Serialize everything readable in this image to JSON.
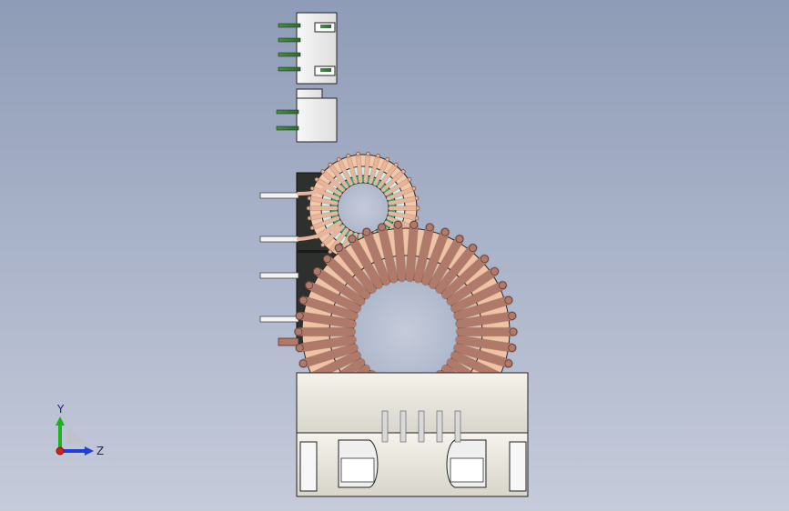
{
  "viewport": {
    "background_top": "#8f9cb7",
    "background_bottom": "#c6cbda"
  },
  "triad": {
    "x_label": "",
    "y_label": "Y",
    "z_label": "Z",
    "y_color": "#1db31d",
    "z_color": "#1f3fd6",
    "x_color": "#d21f1f"
  },
  "model": {
    "parts": [
      {
        "name": "connector-4pin",
        "icon": "connector-icon"
      },
      {
        "name": "connector-2pin",
        "icon": "connector-icon"
      },
      {
        "name": "small-toroid-coil",
        "icon": "toroid-coil-icon"
      },
      {
        "name": "large-toroid-coil",
        "icon": "toroid-coil-icon"
      },
      {
        "name": "base-mount",
        "icon": "base-mount-icon"
      },
      {
        "name": "dark-bracket",
        "icon": "bracket-icon"
      }
    ],
    "colors": {
      "copper": "#b07a6a",
      "copper_light": "#e7b59d",
      "core_green": "#20c29a",
      "plastic": "#f2f2f2",
      "pin_green": "#2f6b2f"
    }
  }
}
